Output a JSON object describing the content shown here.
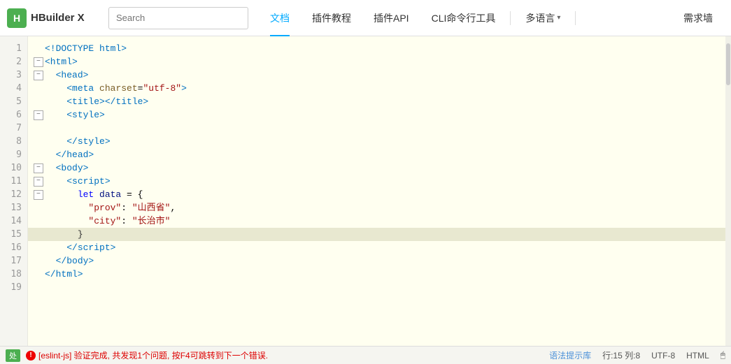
{
  "header": {
    "logo_icon": "H",
    "logo_text": "HBuilder X",
    "search_placeholder": "Search",
    "nav_items": [
      {
        "label": "文档",
        "active": true
      },
      {
        "label": "插件教程",
        "active": false
      },
      {
        "label": "插件API",
        "active": false
      },
      {
        "label": "CLI命令行工具",
        "active": false
      },
      {
        "label": "多语言",
        "active": false,
        "dropdown": true
      },
      {
        "label": "需求墙",
        "active": false
      }
    ]
  },
  "editor": {
    "lines": [
      {
        "num": 1,
        "indent": 0,
        "fold": false,
        "content_html": "<span class='tok-tag'>&lt;!DOCTYPE html&gt;</span>"
      },
      {
        "num": 2,
        "indent": 0,
        "fold": true,
        "content_html": "<span class='tok-tag'>&lt;html&gt;</span>"
      },
      {
        "num": 3,
        "indent": 1,
        "fold": true,
        "content_html": "  <span class='tok-tag'>&lt;head&gt;</span>"
      },
      {
        "num": 4,
        "indent": 2,
        "fold": false,
        "content_html": "    <span class='tok-tag'>&lt;meta</span> <span class='tok-attr'>charset</span>=<span class='tok-string'>\"utf-8\"</span><span class='tok-tag'>&gt;</span>"
      },
      {
        "num": 5,
        "indent": 2,
        "fold": false,
        "content_html": "    <span class='tok-tag'>&lt;title&gt;&lt;/title&gt;</span>"
      },
      {
        "num": 6,
        "indent": 2,
        "fold": true,
        "content_html": "    <span class='tok-tag'>&lt;style&gt;</span>"
      },
      {
        "num": 7,
        "indent": 3,
        "fold": false,
        "content_html": ""
      },
      {
        "num": 8,
        "indent": 3,
        "fold": false,
        "content_html": "    <span class='tok-tag'>&lt;/style&gt;</span>",
        "extra_indent": true
      },
      {
        "num": 9,
        "indent": 2,
        "fold": false,
        "content_html": "  <span class='tok-tag'>&lt;/head&gt;</span>"
      },
      {
        "num": 10,
        "indent": 1,
        "fold": true,
        "content_html": "  <span class='tok-tag'>&lt;body&gt;</span>"
      },
      {
        "num": 11,
        "indent": 2,
        "fold": true,
        "content_html": "    <span class='tok-tag'>&lt;script&gt;</span>"
      },
      {
        "num": 12,
        "indent": 3,
        "fold": true,
        "content_html": "      <span class='tok-kw'>let</span> <span class='tok-var'>data</span> = {"
      },
      {
        "num": 13,
        "indent": 4,
        "fold": false,
        "content_html": "        <span class='tok-string'>\"prov\"</span>: <span class='tok-chinese-str'>\"山西省\"</span>,"
      },
      {
        "num": 14,
        "indent": 4,
        "fold": false,
        "content_html": "        <span class='tok-string'>\"city\"</span>: <span class='tok-chinese-str'>\"长治市\"</span>"
      },
      {
        "num": 15,
        "indent": 3,
        "fold": false,
        "content_html": "      <span class='tok-bracket'>}</span>",
        "highlighted": true
      },
      {
        "num": 16,
        "indent": 2,
        "fold": false,
        "content_html": "    <span class='tok-tag'>&lt;/script&gt;</span>"
      },
      {
        "num": 17,
        "indent": 1,
        "fold": false,
        "content_html": "  <span class='tok-tag'>&lt;/body&gt;</span>"
      },
      {
        "num": 18,
        "indent": 0,
        "fold": false,
        "content_html": "<span class='tok-tag'>&lt;/html&gt;</span>"
      },
      {
        "num": 19,
        "indent": 0,
        "fold": false,
        "content_html": ""
      }
    ]
  },
  "status_bar": {
    "breadcrumb": "处",
    "error_icon": "!",
    "error_text": "[eslint-js] 验证完成, 共发现1个问题, 按F4可跳转到下一个错误.",
    "hint_text": "语法提示库",
    "cursor": "行:15  列:8",
    "encoding": "UTF-8",
    "file_type": "HTML",
    "mouse_icon": "🖱"
  }
}
